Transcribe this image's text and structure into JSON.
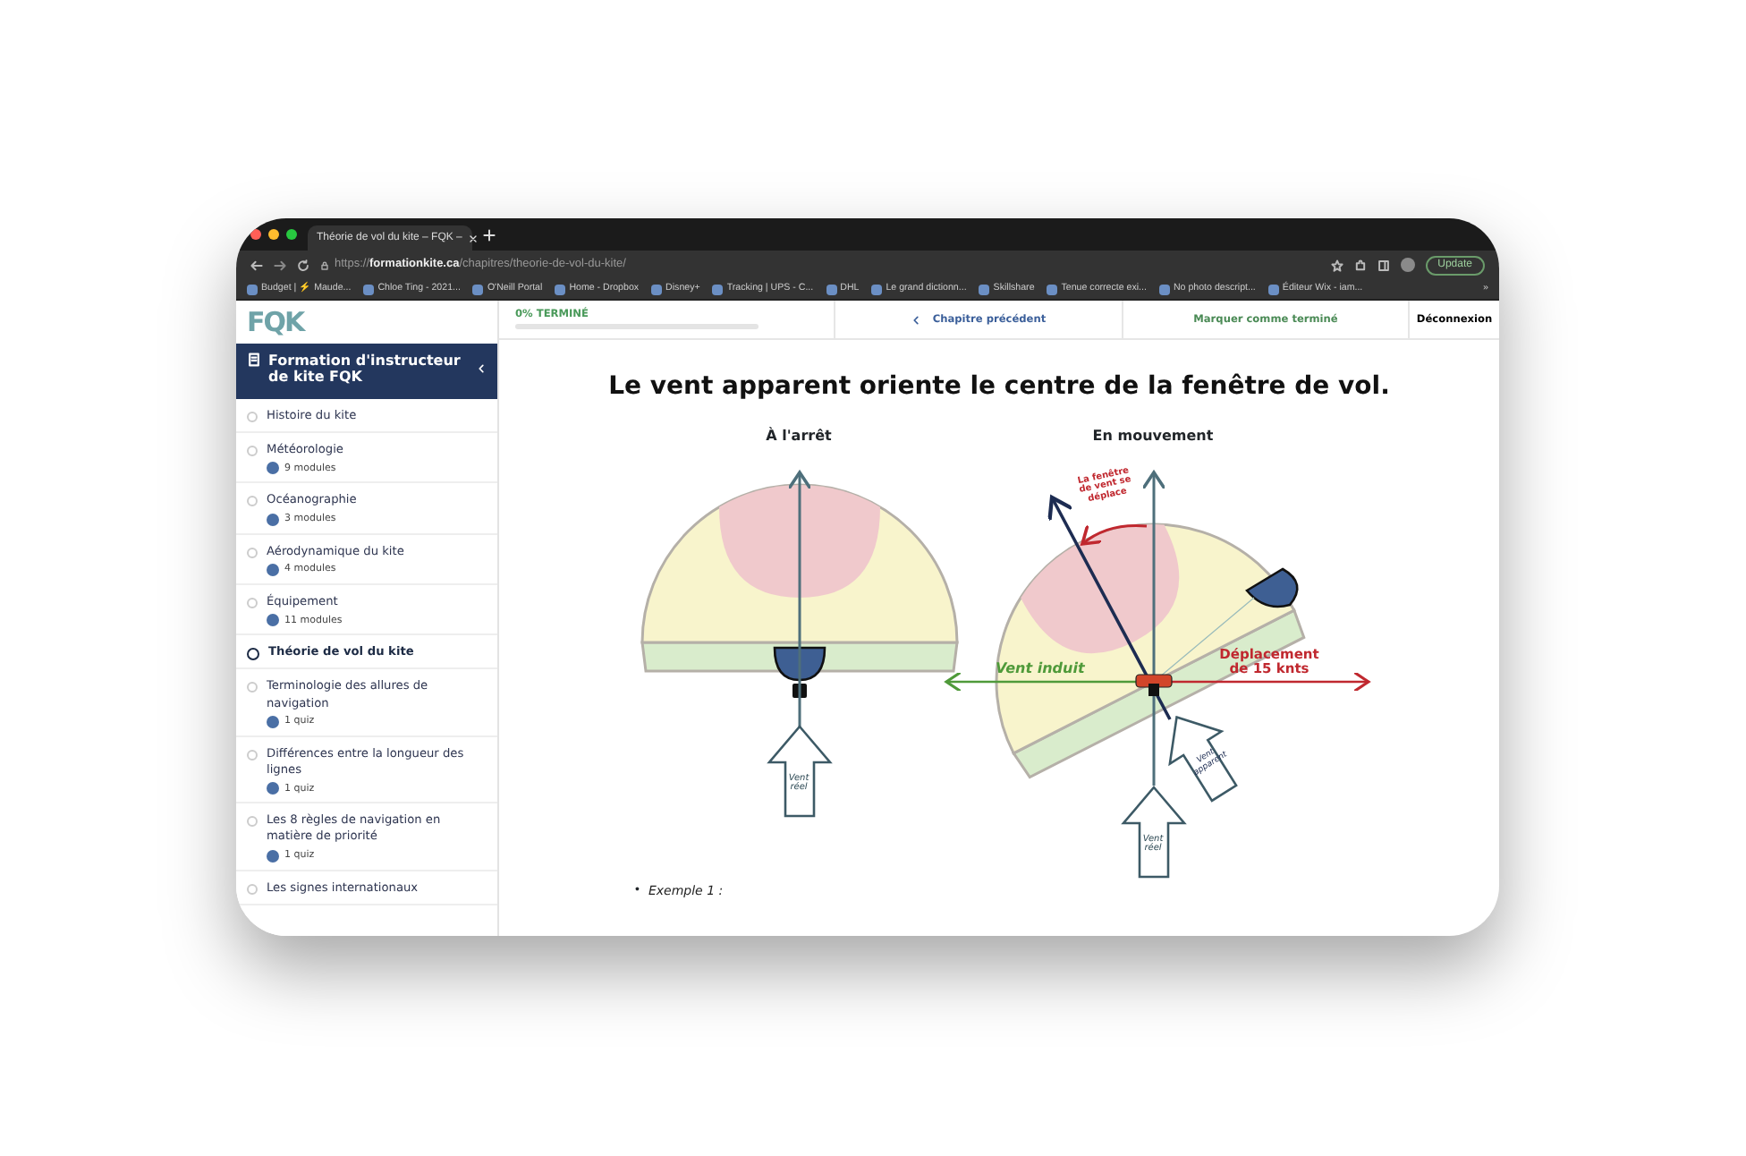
{
  "browser": {
    "tab_title": "Théorie de vol du kite – FQK –",
    "url_scheme": "https://",
    "url_host": "formationkite.ca",
    "url_path": "/chapitres/theorie-de-vol-du-kite/",
    "update_button": "Update",
    "bookmarks": [
      "Budget | ⚡ Maude...",
      "Chloe Ting - 2021...",
      "O'Neill Portal",
      "Home - Dropbox",
      "Disney+",
      "Tracking | UPS - C...",
      "DHL",
      "Le grand dictionn...",
      "Skillshare",
      "Tenue correcte exi...",
      "No photo descript...",
      "Éditeur Wix - iam..."
    ],
    "bookmarks_more": "»"
  },
  "sidebar": {
    "logo": "FQK",
    "course_title": "Formation d'instructeur de kite FQK",
    "items": [
      {
        "title": "Histoire du kite",
        "selected": false
      },
      {
        "title": "Météorologie",
        "meta": "9 modules",
        "selected": false
      },
      {
        "title": "Océanographie",
        "meta": "3 modules",
        "selected": false
      },
      {
        "title": "Aérodynamique du kite",
        "meta": "4 modules",
        "selected": false
      },
      {
        "title": "Équipement",
        "meta": "11 modules",
        "selected": false
      },
      {
        "title": "Théorie de vol du kite",
        "selected": true
      },
      {
        "title": "Terminologie des allures de navigation",
        "meta": "1 quiz",
        "selected": false
      },
      {
        "title": "Différences entre la longueur des lignes",
        "meta": "1 quiz",
        "selected": false
      },
      {
        "title": "Les 8 règles de navigation en matière de priorité",
        "meta": "1 quiz",
        "selected": false
      },
      {
        "title": "Les signes internationaux",
        "selected": false
      }
    ]
  },
  "topbar": {
    "progress": {
      "label": "0% TERMINÉ",
      "level": 0
    },
    "previous": "Chapitre précédent",
    "mark_complete": "Marquer comme terminé",
    "logout": "Déconnexion"
  },
  "content": {
    "title": "Le vent apparent oriente le centre de la fenêtre de vol.",
    "diagram": {
      "left_title": "À l'arrêt",
      "right_title": "En mouvement",
      "left_wind": "Vent réel",
      "window_moves": "La fenêtre de vent se déplace",
      "induced_wind": "Vent induit",
      "movement": "Déplacement de 15 knts",
      "apparent_wind": "Vent apparent",
      "right_wind": "Vent réel"
    },
    "list": [
      {
        "bullet": "•",
        "text": "Exemple 1 :"
      }
    ]
  }
}
